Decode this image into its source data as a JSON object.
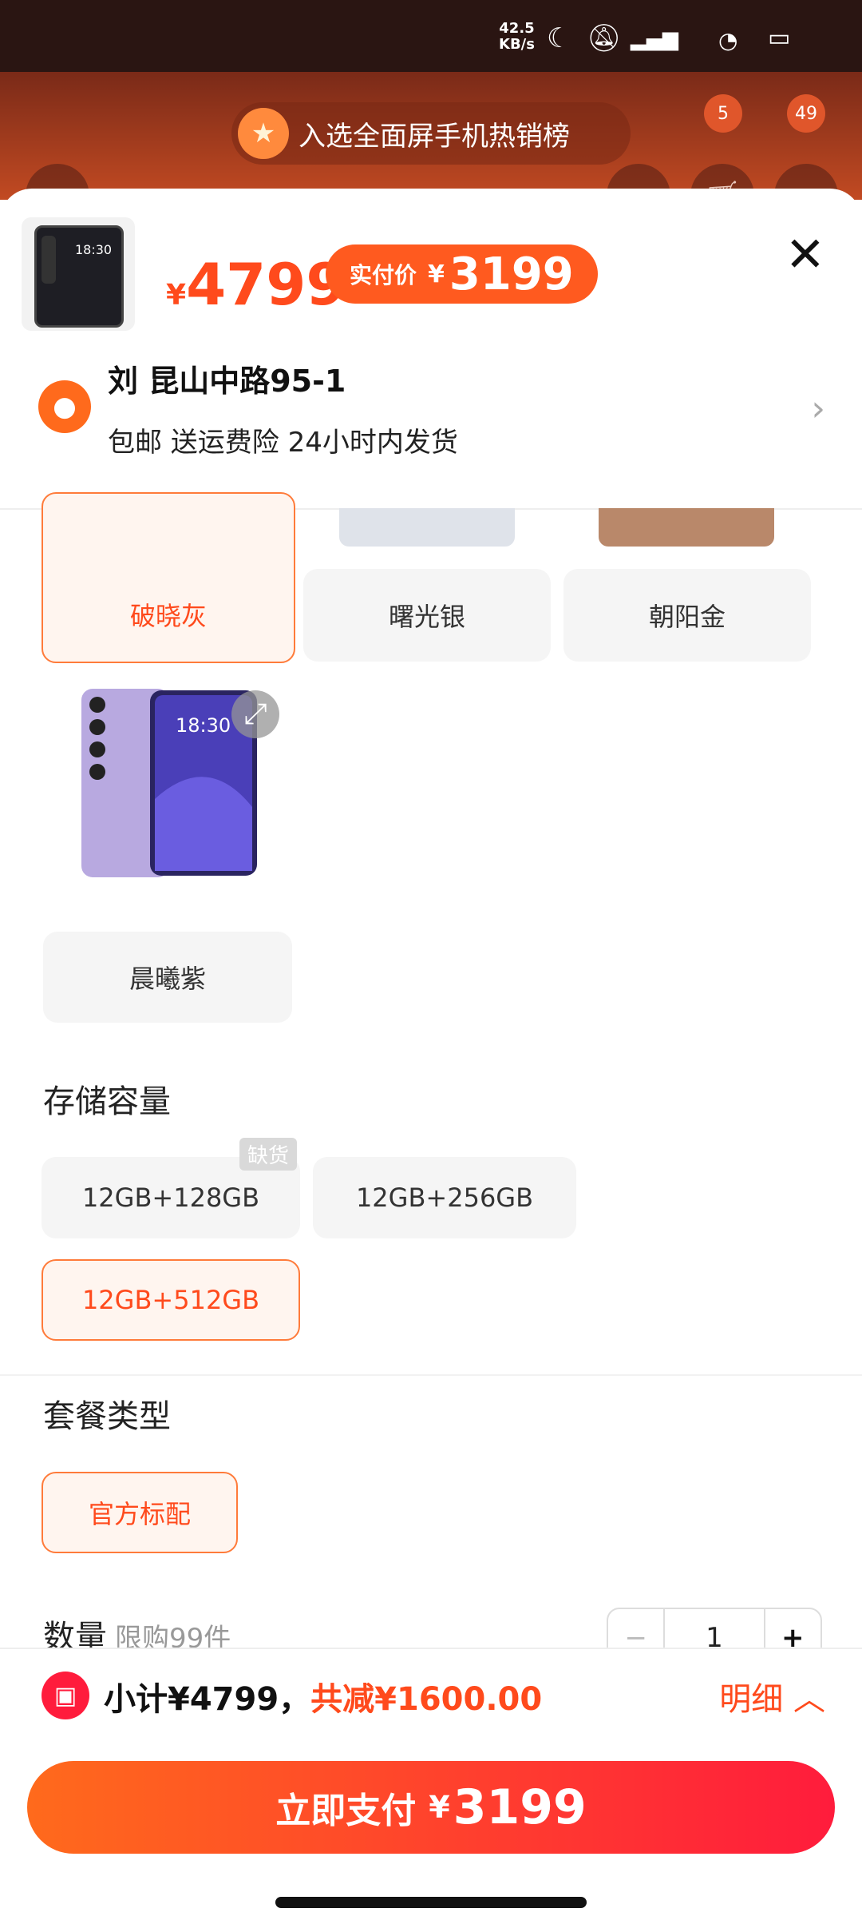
{
  "status_bar": {
    "net_speed": "42.5",
    "net_unit": "KB/s"
  },
  "background": {
    "cart_count": "5",
    "msg_count": "49"
  },
  "banner": {
    "text": "入选全面屏手机热销榜"
  },
  "sheet": {
    "thumb_time": "18:30",
    "price_original": "4799",
    "currency": "¥",
    "pay_label": "实付价",
    "pay_price": "3199",
    "address": {
      "name_line": "刘 昆山中路95-1",
      "service_line": "包邮 送运费险 24小时内发货"
    },
    "colors": [
      {
        "label": "破晓灰",
        "selected": true
      },
      {
        "label": "曙光银",
        "selected": false
      },
      {
        "label": "朝阳金",
        "selected": false
      },
      {
        "label": "晨曦紫",
        "selected": false
      }
    ],
    "purple_time": "18:30",
    "storage_title": "存储容量",
    "storage": [
      {
        "label": "12GB+128GB",
        "tag": "缺货"
      },
      {
        "label": "12GB+256GB"
      },
      {
        "label": "12GB+512GB",
        "selected": true
      }
    ],
    "package_title": "套餐类型",
    "package": [
      {
        "label": "官方标配",
        "selected": true
      }
    ],
    "quantity_title": "数量",
    "quantity_limit": "限购99件",
    "quantity_value": "1"
  },
  "bottom": {
    "subtotal": "小计¥4799，",
    "discount": "共减¥1600.00",
    "detail_label": "明细",
    "pay_label": "立即支付",
    "pay_currency": "¥",
    "pay_price": "3199"
  },
  "colors": {
    "accent": "#ff4a1c",
    "pay_gradient_start": "#ff6a1c",
    "pay_gradient_end": "#ff1c3c"
  }
}
